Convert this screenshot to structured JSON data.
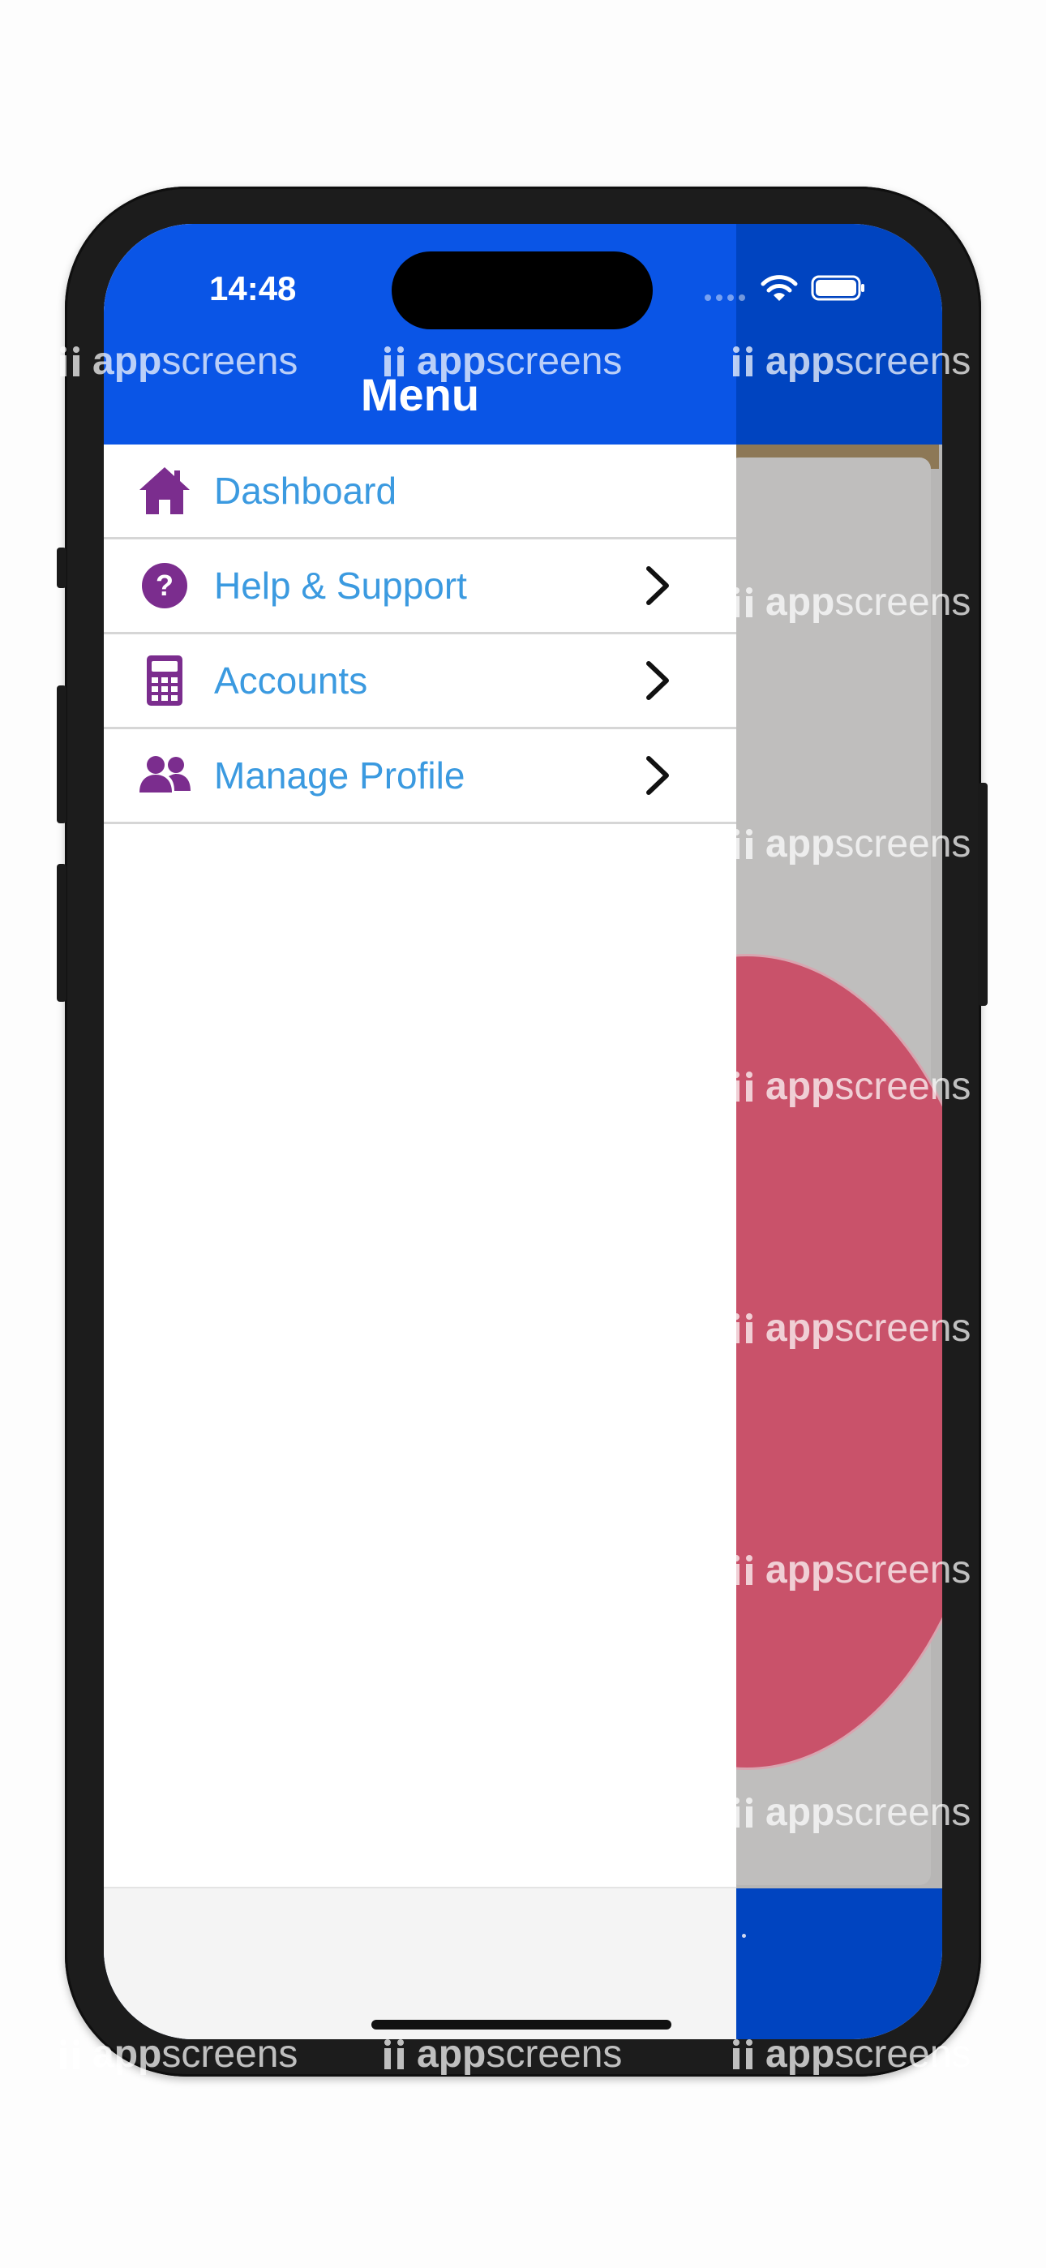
{
  "status_bar": {
    "time": "14:48"
  },
  "drawer": {
    "title": "Menu",
    "items": [
      {
        "label": "Dashboard",
        "icon": "home-icon",
        "has_chevron": false
      },
      {
        "label": "Help & Support",
        "icon": "help-circle-icon",
        "has_chevron": true
      },
      {
        "label": "Accounts",
        "icon": "calculator-icon",
        "has_chevron": true
      },
      {
        "label": "Manage Profile",
        "icon": "users-icon",
        "has_chevron": true
      }
    ]
  },
  "watermark": {
    "bold": "app",
    "rest": "screens"
  },
  "colors": {
    "header_blue": "#0a55e6",
    "menu_text": "#3b9ae0",
    "icon_purple": "#7b2d8e",
    "backdrop_red": "#c9526a"
  }
}
